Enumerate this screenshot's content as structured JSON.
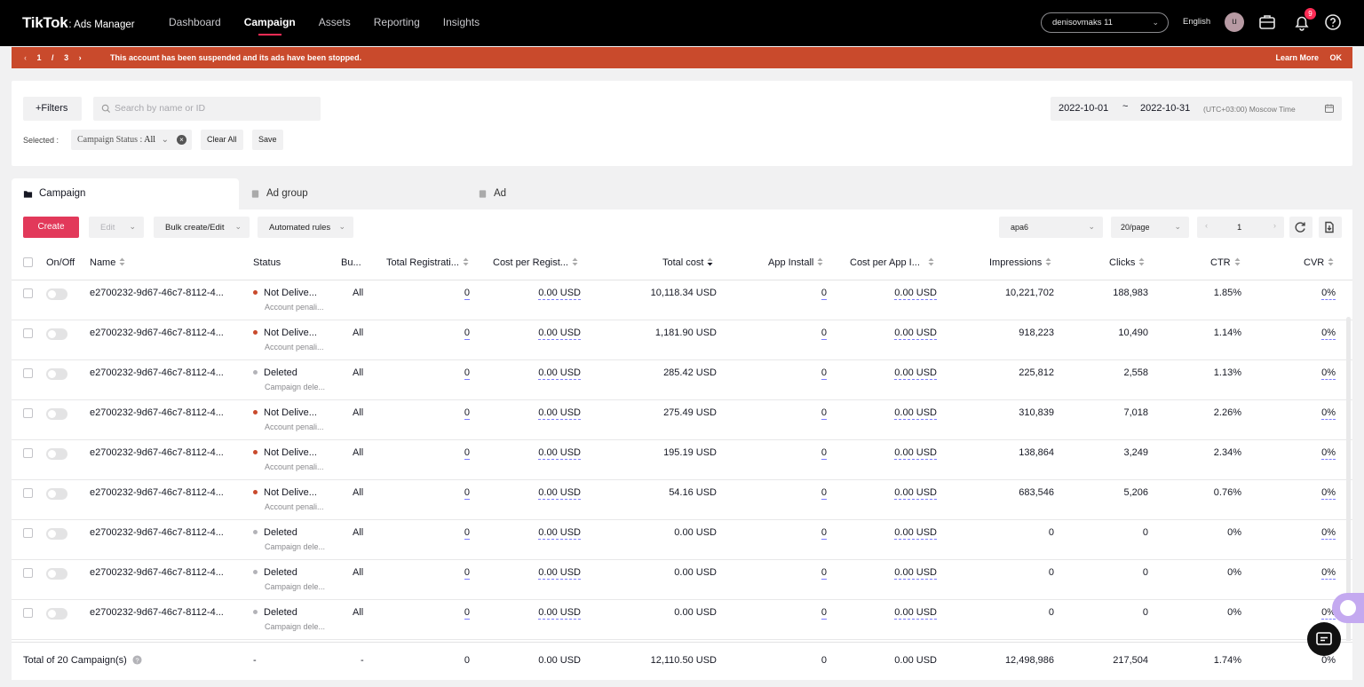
{
  "brand": {
    "logo_main": "TikTok",
    "logo_sub": ": Ads Manager"
  },
  "nav": {
    "items": [
      {
        "label": "Dashboard"
      },
      {
        "label": "Campaign"
      },
      {
        "label": "Assets"
      },
      {
        "label": "Reporting"
      },
      {
        "label": "Insights"
      }
    ],
    "active": "Campaign"
  },
  "header": {
    "account": "denisovmaks 11",
    "language": "English",
    "avatar_letter": "u",
    "notification_count": "9"
  },
  "banner": {
    "page_current": "1",
    "page_sep": "/",
    "page_total": "3",
    "message": "This account has been suspended and its ads have been stopped.",
    "learn_more": "Learn More",
    "ok": "OK",
    "color": "#c94a2c"
  },
  "filters": {
    "filters_label": "+Filters",
    "search_placeholder": "Search by name or ID",
    "selected_label": "Selected :",
    "chip_key": "Campaign Status :",
    "chip_value": "All",
    "clear_all": "Clear All",
    "save": "Save",
    "date_start": "2022-10-01",
    "date_sep": "~",
    "date_end": "2022-10-31",
    "timezone": "(UTC+03:00) Moscow Time"
  },
  "tabs": [
    {
      "label": "Campaign"
    },
    {
      "label": "Ad group"
    },
    {
      "label": "Ad"
    }
  ],
  "toolbar": {
    "create": "Create",
    "edit": "Edit",
    "bulk": "Bulk create/Edit",
    "automated": "Automated rules",
    "view_select": "ара6",
    "page_size": "20/page",
    "page": "1"
  },
  "table": {
    "headers": {
      "on_off": "On/Off",
      "name": "Name",
      "status": "Status",
      "budget": "Bu...",
      "total_reg": "Total Registrati...",
      "cost_per_reg": "Cost per Regist...",
      "total_cost": "Total cost",
      "app_install": "App Install",
      "cost_per_app": "Cost per App I...",
      "impressions": "Impressions",
      "clicks": "Clicks",
      "ctr": "CTR",
      "cvr": "CVR"
    },
    "rows": [
      {
        "name": "e2700232-9d67-46c7-8112-4...",
        "status": "Not Delive...",
        "status_sub": "Account penali...",
        "status_color": "#c94a2c",
        "budget": "All",
        "total_reg": "0",
        "cost_per_reg": "0.00 USD",
        "total_cost": "10,118.34 USD",
        "app_install": "0",
        "cost_per_app": "0.00 USD",
        "impressions": "10,221,702",
        "clicks": "188,983",
        "ctr": "1.85%",
        "cvr": "0%"
      },
      {
        "name": "e2700232-9d67-46c7-8112-4...",
        "status": "Not Delive...",
        "status_sub": "Account penali...",
        "status_color": "#c94a2c",
        "budget": "All",
        "total_reg": "0",
        "cost_per_reg": "0.00 USD",
        "total_cost": "1,181.90 USD",
        "app_install": "0",
        "cost_per_app": "0.00 USD",
        "impressions": "918,223",
        "clicks": "10,490",
        "ctr": "1.14%",
        "cvr": "0%"
      },
      {
        "name": "e2700232-9d67-46c7-8112-4...",
        "status": "Deleted",
        "status_sub": "Campaign dele...",
        "status_color": "#b3b3b8",
        "budget": "All",
        "total_reg": "0",
        "cost_per_reg": "0.00 USD",
        "total_cost": "285.42 USD",
        "app_install": "0",
        "cost_per_app": "0.00 USD",
        "impressions": "225,812",
        "clicks": "2,558",
        "ctr": "1.13%",
        "cvr": "0%"
      },
      {
        "name": "e2700232-9d67-46c7-8112-4...",
        "status": "Not Delive...",
        "status_sub": "Account penali...",
        "status_color": "#c94a2c",
        "budget": "All",
        "total_reg": "0",
        "cost_per_reg": "0.00 USD",
        "total_cost": "275.49 USD",
        "app_install": "0",
        "cost_per_app": "0.00 USD",
        "impressions": "310,839",
        "clicks": "7,018",
        "ctr": "2.26%",
        "cvr": "0%"
      },
      {
        "name": "e2700232-9d67-46c7-8112-4...",
        "status": "Not Delive...",
        "status_sub": "Account penali...",
        "status_color": "#c94a2c",
        "budget": "All",
        "total_reg": "0",
        "cost_per_reg": "0.00 USD",
        "total_cost": "195.19 USD",
        "app_install": "0",
        "cost_per_app": "0.00 USD",
        "impressions": "138,864",
        "clicks": "3,249",
        "ctr": "2.34%",
        "cvr": "0%"
      },
      {
        "name": "e2700232-9d67-46c7-8112-4...",
        "status": "Not Delive...",
        "status_sub": "Account penali...",
        "status_color": "#c94a2c",
        "budget": "All",
        "total_reg": "0",
        "cost_per_reg": "0.00 USD",
        "total_cost": "54.16 USD",
        "app_install": "0",
        "cost_per_app": "0.00 USD",
        "impressions": "683,546",
        "clicks": "5,206",
        "ctr": "0.76%",
        "cvr": "0%"
      },
      {
        "name": "e2700232-9d67-46c7-8112-4...",
        "status": "Deleted",
        "status_sub": "Campaign dele...",
        "status_color": "#b3b3b8",
        "budget": "All",
        "total_reg": "0",
        "cost_per_reg": "0.00 USD",
        "total_cost": "0.00 USD",
        "app_install": "0",
        "cost_per_app": "0.00 USD",
        "impressions": "0",
        "clicks": "0",
        "ctr": "0%",
        "cvr": "0%"
      },
      {
        "name": "e2700232-9d67-46c7-8112-4...",
        "status": "Deleted",
        "status_sub": "Campaign dele...",
        "status_color": "#b3b3b8",
        "budget": "All",
        "total_reg": "0",
        "cost_per_reg": "0.00 USD",
        "total_cost": "0.00 USD",
        "app_install": "0",
        "cost_per_app": "0.00 USD",
        "impressions": "0",
        "clicks": "0",
        "ctr": "0%",
        "cvr": "0%"
      },
      {
        "name": "e2700232-9d67-46c7-8112-4...",
        "status": "Deleted",
        "status_sub": "Campaign dele...",
        "status_color": "#b3b3b8",
        "budget": "All",
        "total_reg": "0",
        "cost_per_reg": "0.00 USD",
        "total_cost": "0.00 USD",
        "app_install": "0",
        "cost_per_app": "0.00 USD",
        "impressions": "0",
        "clicks": "0",
        "ctr": "0%",
        "cvr": "0%"
      }
    ],
    "total": {
      "label": "Total of 20 Campaign(s)",
      "status": "-",
      "budget": "-",
      "total_reg": "0",
      "cost_per_reg": "0.00 USD",
      "total_cost": "12,110.50 USD",
      "app_install": "0",
      "cost_per_app": "0.00 USD",
      "impressions": "12,498,986",
      "clicks": "217,504",
      "ctr": "1.74%",
      "cvr": "0%"
    }
  },
  "colors": {
    "accent": "#fe2c55",
    "create_button": "#e2395a",
    "link_underline": "#7c7cff"
  }
}
